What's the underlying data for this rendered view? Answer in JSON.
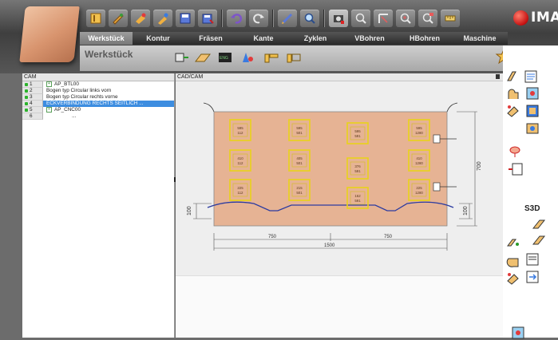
{
  "app": {
    "logo_text": "IMA",
    "brand_color": "#c41010"
  },
  "toolbar": {
    "icons": [
      "program-icon",
      "tool-icon",
      "paint-icon",
      "brush-icon",
      "save-icon",
      "save-as-icon",
      "undo-icon",
      "redo-icon",
      "pen-icon",
      "zoom-icon",
      "camera-icon",
      "zoom-out-icon",
      "measure-icon",
      "zoom-in-icon",
      "ruler-icon"
    ]
  },
  "menu": {
    "items": [
      "Werkstück",
      "Kontur",
      "Fräsen",
      "Kante",
      "Zyklen",
      "VBohren",
      "HBohren",
      "Maschine"
    ],
    "active": "Werkstück"
  },
  "subheader": {
    "title": "Werkstück"
  },
  "left_panel": {
    "header": "CAM",
    "rows": [
      {
        "num": "1",
        "text": "AP_BTL00",
        "expand": true,
        "dot": true
      },
      {
        "num": "2",
        "text": "Bogen typ Circular links vorn",
        "expand": false,
        "dot": true
      },
      {
        "num": "3",
        "text": "Bogen typ Circular rechts vorne",
        "expand": false,
        "dot": true
      },
      {
        "num": "4",
        "text": "ECKVERBINDUNG RECHTS SEITLICH ...",
        "expand": false,
        "dot": true,
        "selected": true
      },
      {
        "num": "5",
        "text": "AP_CNC00",
        "expand": true,
        "dot": true
      },
      {
        "num": "6",
        "text": "...",
        "expand": false,
        "dot": false
      }
    ]
  },
  "canvas": {
    "header": "CAD/CAM",
    "panel_color": "#e6b394",
    "dims": {
      "height": "700",
      "width": "1500",
      "half_left": "750",
      "half_right": "750",
      "left_offset": "100",
      "right_offset": "100"
    },
    "boxes": [
      {
        "l1": "595",
        "l2": "112"
      },
      {
        "l1": "595",
        "l2": "501"
      },
      {
        "l1": "595",
        "l2": "591"
      },
      {
        "l1": "595",
        "l2": "1280"
      },
      {
        "l1": "410",
        "l2": "112"
      },
      {
        "l1": "405",
        "l2": "501"
      },
      {
        "l1": "376",
        "l2": "591"
      },
      {
        "l1": "410",
        "l2": "1280"
      },
      {
        "l1": "225",
        "l2": "112"
      },
      {
        "l1": "215",
        "l2": "501"
      },
      {
        "l1": "162",
        "l2": "591"
      },
      {
        "l1": "225",
        "l2": "1280"
      }
    ]
  },
  "right_panel": {
    "label": "S3D"
  }
}
